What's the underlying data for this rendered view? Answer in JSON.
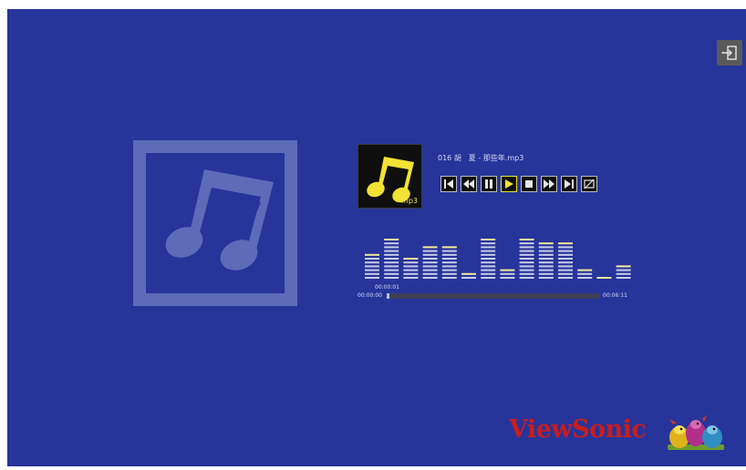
{
  "player": {
    "track_title": "016 胡　夏 - 那些年.mp3",
    "thumb_label": "mp3",
    "time_current": "00:00:01",
    "time_start": "00:00:00",
    "time_end": "00:06:11",
    "progress_fraction": 0.004,
    "controls": [
      {
        "name": "skip-back-icon"
      },
      {
        "name": "rewind-icon"
      },
      {
        "name": "pause-icon"
      },
      {
        "name": "play-icon",
        "active": true
      },
      {
        "name": "stop-icon"
      },
      {
        "name": "fast-forward-icon"
      },
      {
        "name": "skip-forward-icon"
      },
      {
        "name": "repeat-off-icon"
      }
    ],
    "equalizer_levels": [
      6,
      10,
      5,
      8,
      8,
      1,
      10,
      2,
      10,
      9,
      9,
      2,
      0,
      3
    ]
  },
  "header": {
    "exit_icon": "exit-icon"
  },
  "brand": {
    "logo_text": "ViewSonic"
  },
  "colors": {
    "background": "#27349a",
    "accent_yellow": "#f2e233",
    "eq_bar": "#c9cde8",
    "eq_peak": "#f1ec9a",
    "logo_red": "#c81e1e"
  }
}
